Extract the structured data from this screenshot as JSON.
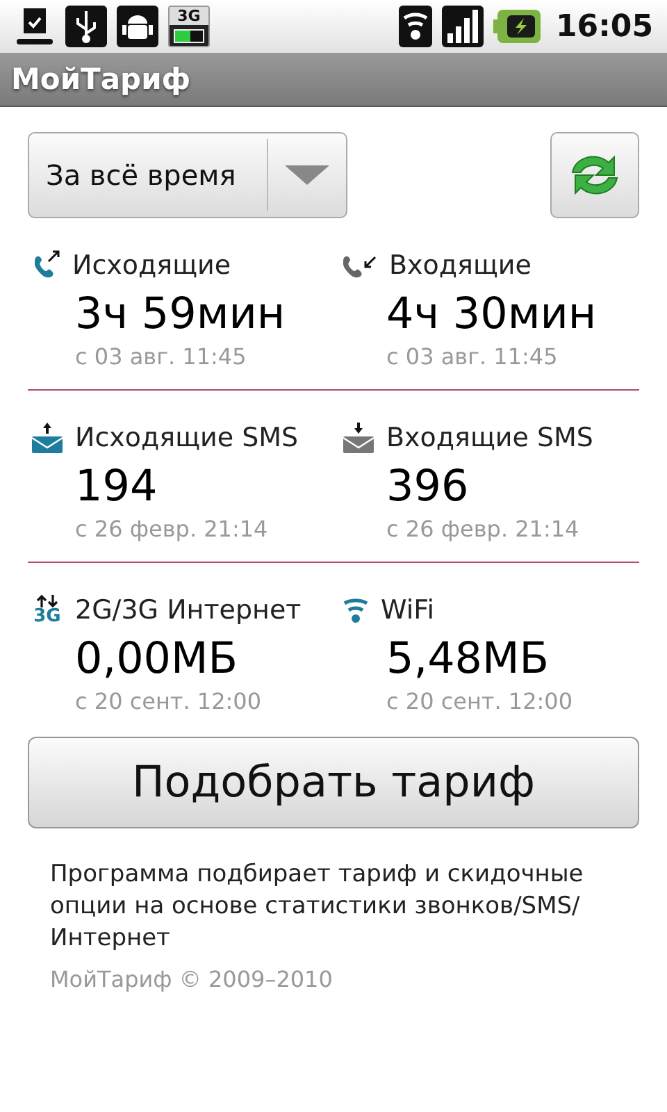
{
  "status_bar": {
    "left_icons": [
      {
        "kind": "download"
      },
      {
        "kind": "usb"
      },
      {
        "kind": "android"
      },
      {
        "kind": "network",
        "label": "3G"
      }
    ],
    "right_icons": [
      {
        "kind": "wifi"
      },
      {
        "kind": "signal"
      },
      {
        "kind": "battery"
      }
    ],
    "time": "16:05"
  },
  "title_bar": {
    "title": "МойТариф"
  },
  "period_dropdown": {
    "value": "За всё время"
  },
  "stat_groups": [
    {
      "items": [
        {
          "kind": "call-out",
          "label": "Исходящие",
          "value": "3ч 59мин",
          "since": "с 03 авг. 11:45"
        },
        {
          "kind": "call-in",
          "label": "Входящие",
          "value": "4ч 30мин",
          "since": "с 03 авг. 11:45"
        }
      ]
    },
    {
      "items": [
        {
          "kind": "sms-out",
          "label": "Исходящие SMS",
          "value": "194",
          "since": "с 26 февр. 21:14"
        },
        {
          "kind": "sms-in",
          "label": "Входящие SMS",
          "value": "396",
          "since": "с 26 февр. 21:14"
        }
      ]
    },
    {
      "items": [
        {
          "kind": "mobile-data",
          "icon_label": "3G",
          "label": "2G/3G Интернет",
          "value": "0,00МБ",
          "since": "с 20 сент. 12:00"
        },
        {
          "kind": "wifi",
          "label": "WiFi",
          "value": "5,48МБ",
          "since": "с 20 сент. 12:00"
        }
      ]
    }
  ],
  "main_button": {
    "label": "Подобрать тариф"
  },
  "description": "Программа подбирает тариф и скидочные опции на основе статистики звонков/SMS/Интернет",
  "copyright": "МойТариф © 2009–2010"
}
